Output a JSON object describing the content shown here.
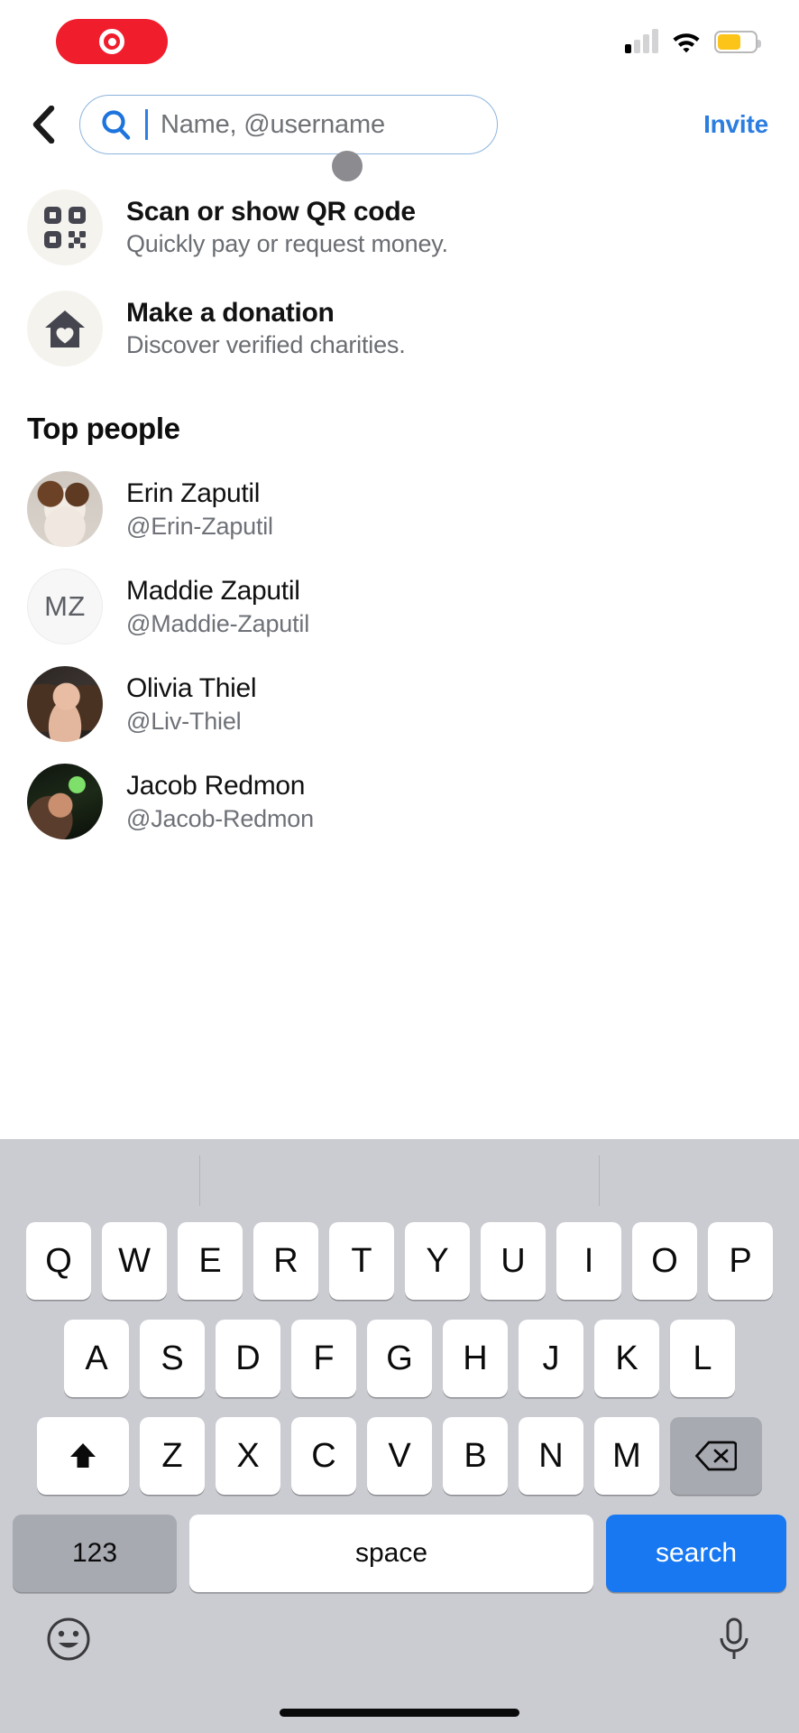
{
  "status_bar": {
    "recording_indicator": "record-pill",
    "signal_icon": "cellular-signal-icon",
    "signal_bars_total": 4,
    "signal_bars_active": 1,
    "wifi_icon": "wifi-icon",
    "battery_icon": "battery-icon",
    "battery_level_percent": 62,
    "battery_color": "#fcc419"
  },
  "header": {
    "back_icon": "chevron-left-icon",
    "search": {
      "icon": "search-icon",
      "placeholder": "Name, @username",
      "value": "",
      "accent_color": "#2b7de0"
    },
    "invite_label": "Invite"
  },
  "actions": [
    {
      "icon": "qr-code-icon",
      "title": "Scan or show QR code",
      "subtitle": "Quickly pay or request money."
    },
    {
      "icon": "house-heart-icon",
      "title": "Make a donation",
      "subtitle": "Discover verified charities."
    }
  ],
  "top_people": {
    "section_title": "Top people",
    "items": [
      {
        "name": "Erin Zaputil",
        "handle": "@Erin-Zaputil",
        "avatar_type": "photo",
        "avatar_style": "ph-dog"
      },
      {
        "name": "Maddie Zaputil",
        "handle": "@Maddie-Zaputil",
        "avatar_type": "initials",
        "initials": "MZ"
      },
      {
        "name": "Olivia Thiel",
        "handle": "@Liv-Thiel",
        "avatar_type": "photo",
        "avatar_style": "ph-olivia"
      },
      {
        "name": "Jacob Redmon",
        "handle": "@Jacob-Redmon",
        "avatar_type": "photo",
        "avatar_style": "ph-jacob"
      }
    ]
  },
  "keyboard": {
    "row1": [
      "Q",
      "W",
      "E",
      "R",
      "T",
      "Y",
      "U",
      "I",
      "O",
      "P"
    ],
    "row2": [
      "A",
      "S",
      "D",
      "F",
      "G",
      "H",
      "J",
      "K",
      "L"
    ],
    "row3": [
      "Z",
      "X",
      "C",
      "V",
      "B",
      "N",
      "M"
    ],
    "shift_icon": "shift-up-arrow-icon",
    "backspace_icon": "backspace-delete-icon",
    "numbers_label": "123",
    "space_label": "space",
    "search_label": "search",
    "search_key_color": "#1778f2",
    "emoji_icon": "emoji-smiley-icon",
    "dictation_icon": "microphone-icon"
  }
}
